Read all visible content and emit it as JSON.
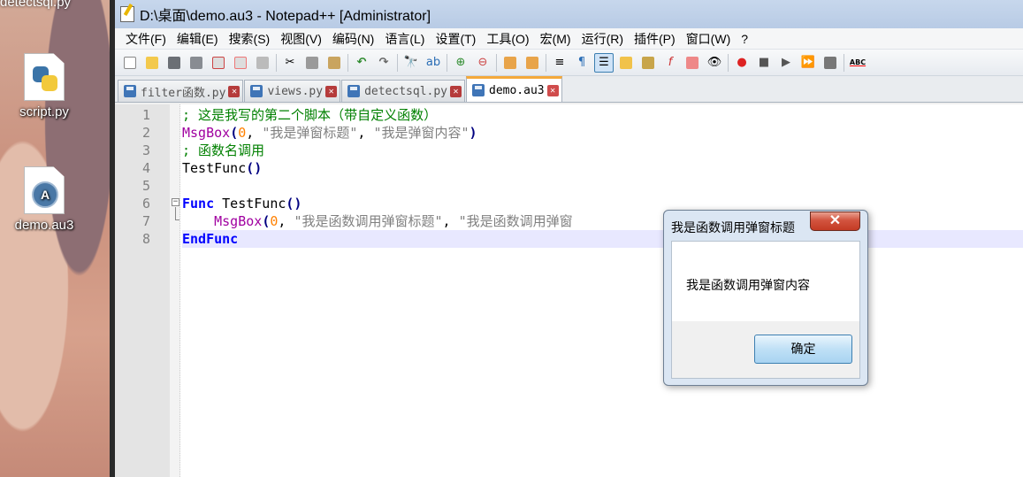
{
  "desktop": {
    "top_label": "detectsql.py",
    "icons": [
      {
        "label": "script.py",
        "icon": "python-file-icon"
      },
      {
        "label": "demo.au3",
        "icon": "autoit-file-icon"
      }
    ]
  },
  "window": {
    "title": "D:\\桌面\\demo.au3 - Notepad++ [Administrator]"
  },
  "menu": [
    "文件(F)",
    "编辑(E)",
    "搜索(S)",
    "视图(V)",
    "编码(N)",
    "语言(L)",
    "设置(T)",
    "工具(O)",
    "宏(M)",
    "运行(R)",
    "插件(P)",
    "窗口(W)",
    "?"
  ],
  "toolbar": {
    "spellcheck_label": "ABC"
  },
  "tabs": [
    {
      "label": "filter函数.py",
      "active": false
    },
    {
      "label": "views.py",
      "active": false
    },
    {
      "label": "detectsql.py",
      "active": false
    },
    {
      "label": "demo.au3",
      "active": true
    }
  ],
  "editor": {
    "line_numbers": [
      "1",
      "2",
      "3",
      "4",
      "5",
      "6",
      "7",
      "8"
    ],
    "lines": {
      "l1": "; 这是我写的第二个脚本（带自定义函数）",
      "l2_func": "MsgBox",
      "l2_open": "(",
      "l2_num": "0",
      "l2_comma": ", ",
      "l2_str1": "\"我是弹窗标题\"",
      "l2_comma2": ", ",
      "l2_str2": "\"我是弹窗内容\"",
      "l2_close": ")",
      "l3": "; 函数名调用",
      "l4_name": "TestFunc",
      "l4_parens": "()",
      "l6_kw": "Func",
      "l6_name": " TestFunc",
      "l6_parens": "()",
      "l7_indent": "    ",
      "l7_func": "MsgBox",
      "l7_open": "(",
      "l7_num": "0",
      "l7_comma": ", ",
      "l7_str1": "\"我是函数调用弹窗标题\"",
      "l7_comma2": ", ",
      "l7_str2": "\"我是函数调用弹窗",
      "l8_kw": "EndFunc"
    },
    "current_line": "8"
  },
  "dialog": {
    "title": "我是函数调用弹窗标题",
    "message": "我是函数调用弹窗内容",
    "ok_label": "确定"
  },
  "colors": {
    "comment": "#008000",
    "function": "#a000a0",
    "number": "#ff8000",
    "string": "#808080",
    "keyword": "#0000ff",
    "active_tab_accent": "#f4a93c"
  }
}
